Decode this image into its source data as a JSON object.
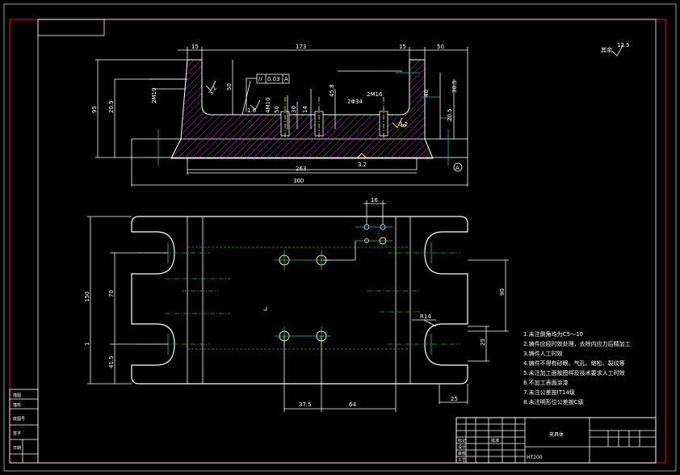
{
  "top_view": {
    "dims": {
      "d15_left": "15",
      "d173": "173",
      "d15_right": "15",
      "d50_right": "50",
      "d95": "95",
      "d20_5": "20.5",
      "d50": "50",
      "d2M10": "2M10",
      "d4M10": "4M10",
      "d20_5r": "20.5",
      "d30_5": "30.5",
      "d263": "263",
      "d300": "300",
      "d2_m8": "2M8",
      "d4_M10": "4M10",
      "d2_34": "2Φ34",
      "d2_16": "2M16",
      "d30": "30",
      "d14": "14",
      "d50b": "50",
      "d40": "40",
      "d45_8": "45.8",
      "d8": "8"
    },
    "tolerance_box": {
      "sym": "//",
      "value": "0.03",
      "datum": "A"
    },
    "surface_labels": {
      "s1": "3.2",
      "s2": "1.6",
      "s3": "3.2",
      "s4": "3.2"
    },
    "datum_marker": "A"
  },
  "plan_view": {
    "dims": {
      "d16": "16",
      "d150": "150",
      "d70": "70",
      "d41_5": "41.5",
      "d37_5": "37.5",
      "d64": "64",
      "d25": "25",
      "dR14": "R14",
      "d25v": "25",
      "d90": "90",
      "d1": "1"
    }
  },
  "corner_roughness": {
    "value": "12.5",
    "label": "其余"
  },
  "notes": [
    "1.未注倒角均为C5～10",
    "2.铸件应经时效处理，去除内应力后精加工",
    "3.铸件人工时效",
    "4.铸件不得有砂眼、气孔、缩松、裂纹等",
    "5.未注加工面按图样及技术要求人工时效",
    "6.不加工表面涂漆",
    "7.未注公差按IT14级",
    "8.未注明形位公差按C级"
  ],
  "title_block": {
    "name": "夹具体",
    "material": "HT200",
    "left_labels": [
      "标记",
      "设计",
      "审核",
      "工艺",
      "批准"
    ]
  },
  "left_strip": {
    "labels": [
      "描图",
      "描校",
      "底图号",
      "签字",
      "日期"
    ]
  }
}
